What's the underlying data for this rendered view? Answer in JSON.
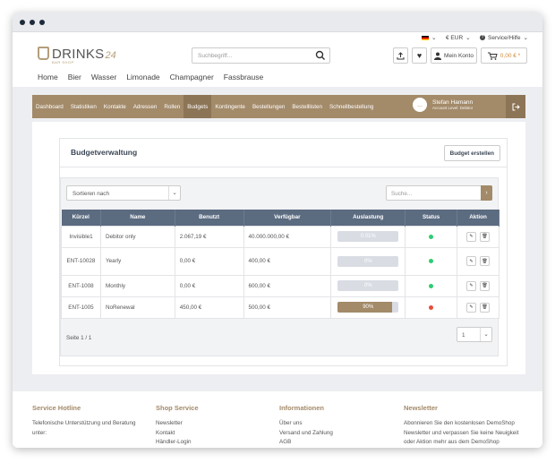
{
  "topbar": {
    "currency": "€ EUR",
    "service": "Service/Hilfe"
  },
  "header": {
    "logo_text": "DRINKS",
    "logo_suffix": "24",
    "logo_sub": "BAR SHOP",
    "search_placeholder": "Suchbegriff...",
    "account_label": "Mein Konto",
    "cart_total": "0,00 € *"
  },
  "nav": [
    "Home",
    "Bier",
    "Wasser",
    "Limonade",
    "Champagner",
    "Fassbrause"
  ],
  "account_nav": [
    "Dashboard",
    "Statistiken",
    "Kontakte",
    "Adressen",
    "Rollen",
    "Budgets",
    "Kontingente",
    "Bestellungen",
    "Bestelllisten",
    "Schnellbestellung"
  ],
  "active_nav": "Budgets",
  "user": {
    "initials": "...",
    "name": "Stefan Hamann",
    "role": "Account Level: Debitor"
  },
  "card": {
    "title": "Budgetverwaltung",
    "create_label": "Budget erstellen"
  },
  "controls": {
    "sort_label": "Sortieren nach",
    "search_placeholder": "Suche..."
  },
  "table": {
    "headers": [
      "Kürzel",
      "Name",
      "Benutzt",
      "Verfügbar",
      "Auslastung",
      "Status",
      "Aktion"
    ],
    "rows": [
      {
        "code": "Invisible1",
        "name": "Debitor only",
        "used": "2.067,19 €",
        "available": "40.000.000,00 €",
        "usage_label": "0.01%",
        "usage": 0.0001,
        "status_color": "#2ecc71"
      },
      {
        "code": "ENT-10028",
        "name": "Yearly",
        "used": "0,00 €",
        "available": "400,00 €",
        "usage_label": "0%",
        "usage": 0,
        "status_color": "#2ecc71"
      },
      {
        "code": "ENT-1008",
        "name": "Monthly",
        "used": "0,00 €",
        "available": "600,00 €",
        "usage_label": "0%",
        "usage": 0,
        "status_color": "#2ecc71"
      },
      {
        "code": "ENT-1005",
        "name": "NoRenewal",
        "used": "450,00 €",
        "available": "500,00 €",
        "usage_label": "90%",
        "usage": 0.9,
        "status_color": "#e74c3c"
      }
    ]
  },
  "pager": {
    "text": "Seite 1 / 1",
    "current": "1"
  },
  "footer": {
    "col1": {
      "title": "Service Hotline",
      "lines": [
        "Telefonische Unterstützung und Beratung",
        "unter:"
      ]
    },
    "col2": {
      "title": "Shop Service",
      "lines": [
        "Newsletter",
        "Kontakt",
        "Händler-Login"
      ]
    },
    "col3": {
      "title": "Informationen",
      "lines": [
        "Über uns",
        "Versand und Zahlung",
        "AGB"
      ]
    },
    "col4": {
      "title": "Newsletter",
      "lines": [
        "Abonnieren Sie den kostenlosen DemoShop",
        "Newsletter und verpassen Sie keine Neuigkeit",
        "oder Aktion mehr aus dem DemoShop"
      ]
    }
  },
  "colors": {
    "accent": "#a38a69",
    "table_header": "#5b6b80",
    "footer_title": "#a38a69"
  }
}
